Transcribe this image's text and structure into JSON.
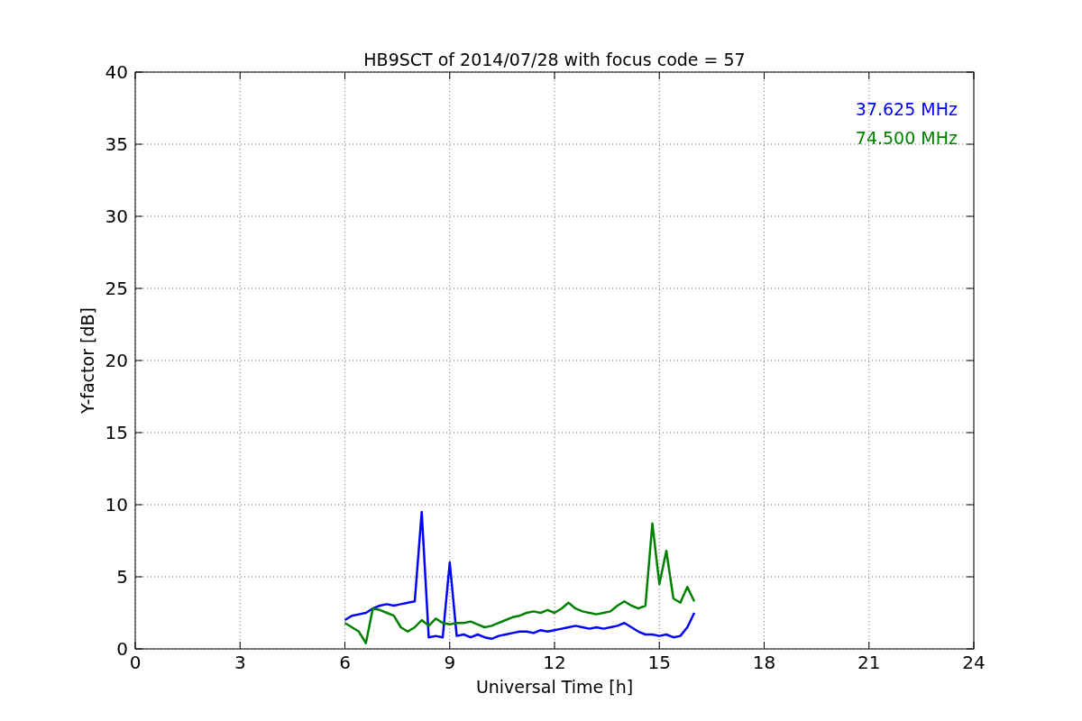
{
  "figure": {
    "chart_data": {
      "type": "line",
      "title": "HB9SCT of 2014/07/28 with focus code = 57",
      "xlabel": "Universal Time [h]",
      "ylabel": "Y-factor [dB]",
      "grid": true,
      "xlim": [
        0,
        24
      ],
      "ylim": [
        0,
        40
      ],
      "xticks": [
        0,
        3,
        6,
        9,
        12,
        15,
        18,
        21,
        24
      ],
      "yticks": [
        0,
        5,
        10,
        15,
        20,
        25,
        30,
        35,
        40
      ],
      "x": [
        6.0,
        6.2,
        6.4,
        6.6,
        6.8,
        7.0,
        7.2,
        7.4,
        7.6,
        7.8,
        8.0,
        8.2,
        8.4,
        8.6,
        8.8,
        9.0,
        9.2,
        9.4,
        9.6,
        9.8,
        10.0,
        10.2,
        10.4,
        10.6,
        10.8,
        11.0,
        11.2,
        11.4,
        11.6,
        11.8,
        12.0,
        12.2,
        12.4,
        12.6,
        12.8,
        13.0,
        13.2,
        13.4,
        13.6,
        13.8,
        14.0,
        14.2,
        14.4,
        14.6,
        14.8,
        15.0,
        15.2,
        15.4,
        15.6,
        15.8,
        16.0
      ],
      "series": [
        {
          "name": "37.625 MHz",
          "color": "#0000ff",
          "values": [
            2.0,
            2.3,
            2.4,
            2.5,
            2.8,
            3.0,
            3.1,
            3.0,
            3.1,
            3.2,
            3.3,
            9.5,
            0.8,
            0.9,
            0.8,
            6.0,
            0.9,
            1.0,
            0.8,
            1.0,
            0.8,
            0.7,
            0.9,
            1.0,
            1.1,
            1.2,
            1.2,
            1.1,
            1.3,
            1.2,
            1.3,
            1.4,
            1.5,
            1.6,
            1.5,
            1.4,
            1.5,
            1.4,
            1.5,
            1.6,
            1.8,
            1.5,
            1.2,
            1.0,
            1.0,
            0.9,
            1.0,
            0.8,
            0.9,
            1.5,
            2.5
          ]
        },
        {
          "name": "74.500 MHz",
          "color": "#008000",
          "values": [
            1.8,
            1.5,
            1.2,
            0.4,
            2.8,
            2.7,
            2.5,
            2.3,
            1.5,
            1.2,
            1.5,
            2.0,
            1.6,
            2.1,
            1.8,
            1.7,
            1.8,
            1.8,
            1.9,
            1.7,
            1.5,
            1.6,
            1.8,
            2.0,
            2.2,
            2.3,
            2.5,
            2.6,
            2.5,
            2.7,
            2.5,
            2.8,
            3.2,
            2.8,
            2.6,
            2.5,
            2.4,
            2.5,
            2.6,
            3.0,
            3.3,
            3.0,
            2.8,
            3.0,
            8.7,
            4.5,
            6.8,
            3.5,
            3.2,
            4.3,
            3.3
          ]
        }
      ]
    }
  }
}
